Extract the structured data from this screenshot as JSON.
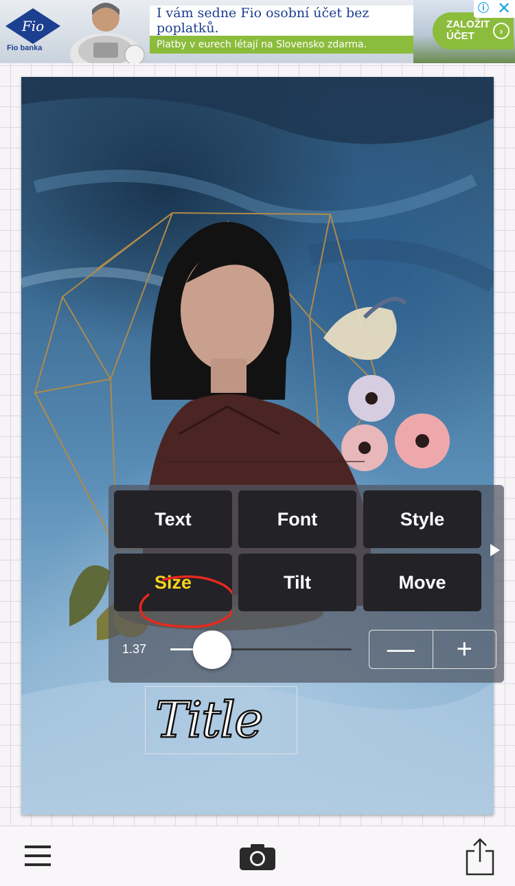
{
  "ad": {
    "logo_label": "Fio",
    "brand": "Fio banka",
    "headline": "I vám sedne Fio osobní účet bez poplatků.",
    "subline": "Platby v eurech létají na Slovensko zdarma.",
    "cta_line1": "ZALOŽIT",
    "cta_line2": "ÚČET",
    "info_glyph": "ⓘ",
    "close_glyph": "✕",
    "colors": {
      "brand_blue": "#1c3f8f",
      "green": "#8cbc3c",
      "info_blue": "#19a3dd"
    }
  },
  "canvas": {
    "title_text": "Title"
  },
  "panel": {
    "buttons": [
      "Text",
      "Font",
      "Style",
      "Size",
      "Tilt",
      "Move"
    ],
    "active_button": "Size",
    "slider_value": "1.37",
    "slider_fraction": 0.23,
    "decrement_glyph": "—",
    "increment_glyph": "+",
    "expand_icon": "triangle-right-icon",
    "colors": {
      "active_text": "#f5d31e",
      "annotation_red": "#e8281e"
    }
  },
  "toolbar": {
    "menu_icon": "hamburger-menu-icon",
    "camera_icon": "camera-icon",
    "share_icon": "share-icon"
  }
}
